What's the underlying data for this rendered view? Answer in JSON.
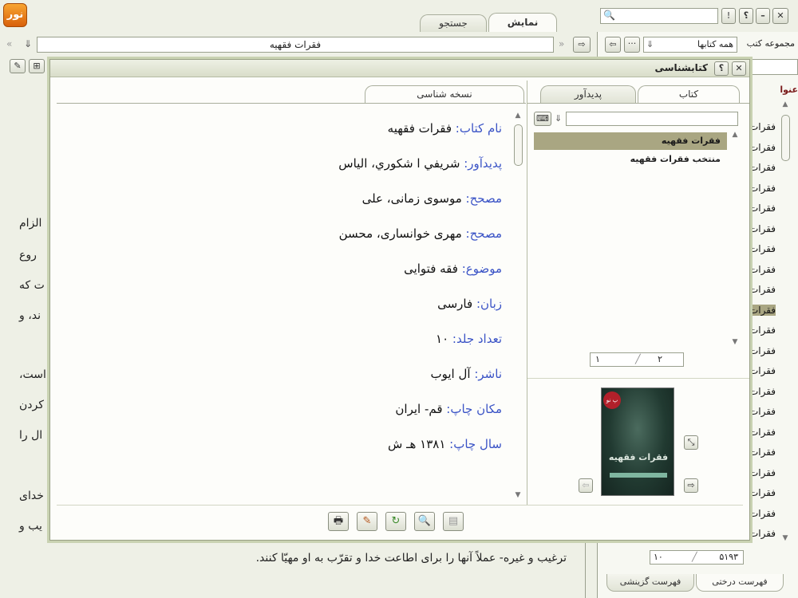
{
  "app": {
    "logo_text": "نور",
    "tabs": {
      "show": "نمایش",
      "search": "جستجو"
    },
    "search_placeholder": "",
    "help_label": "؟",
    "exclaim_label": "!",
    "min_label": "–",
    "close_label": "✕"
  },
  "library": {
    "collection_label": "مجموعه کتب",
    "collection_value": "همه کتابها",
    "title_header": "عنوا",
    "items": [
      "فقرات",
      "فقرات",
      "فقرات",
      "فقرات",
      "فقرات",
      "فقرات",
      "فقرات",
      "فقرات",
      "فقرات",
      "فقرات",
      "فقرات",
      "فقرات",
      "فقرات",
      "فقرات",
      "فقرات",
      "فقرات",
      "فقرات",
      "فقرات",
      "فقرات",
      "فقرات",
      "فقرات"
    ],
    "selected_index": 9,
    "pager_current": "۱۰",
    "pager_total": "۵۱۹۳",
    "bottom_tabs": {
      "tree": "فهرست درختی",
      "select": "فهرست گزینشی"
    }
  },
  "reader": {
    "book_title": "فقرات فقهیه",
    "text_lines": [
      "الزام",
      "روع",
      "ت که",
      "ند، و",
      "است،",
      "کردن",
      "ال را",
      "خدای",
      "یب و"
    ],
    "bottom_line": "ترغیب و غیره- عملاً آنها را برای اطاعت خدا و تقرّب به او مهیّا کنند."
  },
  "dialog": {
    "title": "کتابشناسی",
    "help_label": "؟",
    "close_label": "✕",
    "left_tabs": {
      "book": "کتاب",
      "author": "پدیدآور"
    },
    "right_tab": "نسخه شناسی",
    "filter_value": "",
    "books": [
      "فقرات فقهیه",
      "منتخب فقرات فقهیه"
    ],
    "books_selected": 0,
    "pager_total": "۲",
    "pager_current": "۱",
    "cover_top": "پ نو",
    "cover_title": "فقرات فقهیه",
    "metadata": [
      {
        "key": "نام کتاب:",
        "value": " فقرات فقهیه"
      },
      {
        "key": "پدیدآور:",
        "value": " شريفي ا شكوري، الياس"
      },
      {
        "key": "مصحح:",
        "value": " موسوی زمانی، علی"
      },
      {
        "key": "مصحح:",
        "value": " مهری خوانساری، محسن"
      },
      {
        "key": "موضوع:",
        "value": " فقه فتوایی"
      },
      {
        "key": "زبان:",
        "value": " فارسی"
      },
      {
        "key": "تعداد جلد:",
        "value": " ۱۰"
      },
      {
        "key": "ناشر:",
        "value": " آل ایوب"
      },
      {
        "key": "مکان چاپ:",
        "value": " قم- ایران"
      },
      {
        "key": "سال چاپ:",
        "value": " ۱۳۸۱ هـ ش"
      }
    ]
  }
}
